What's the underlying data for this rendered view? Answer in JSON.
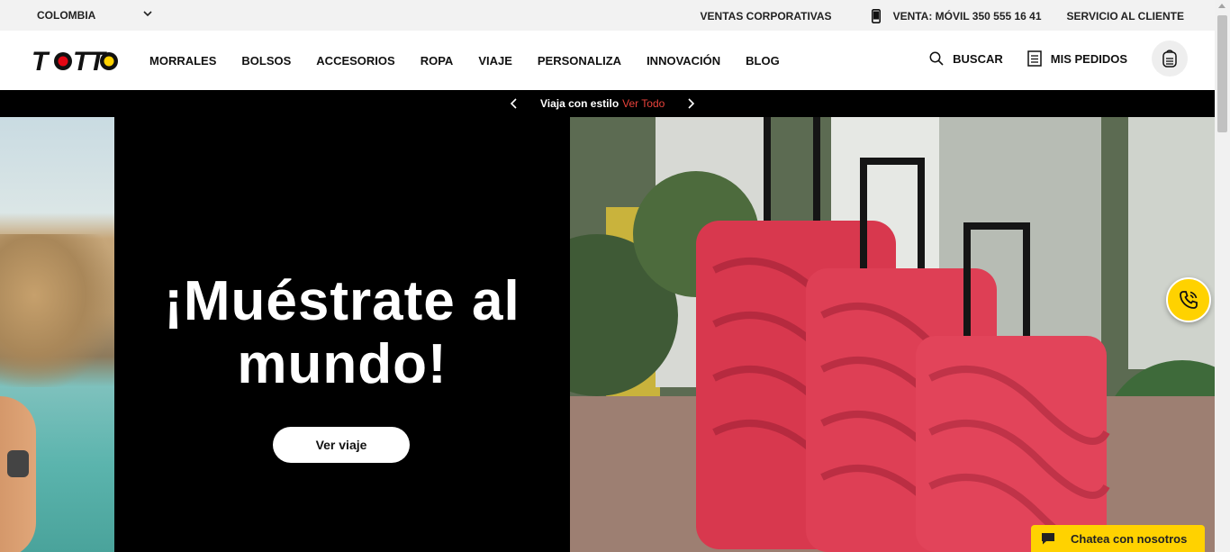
{
  "topbar": {
    "country": "COLOMBIA",
    "corporate_sales": "VENTAS CORPORATIVAS",
    "phone_sales": "VENTA: MÓVIL 350 555 16 41",
    "customer_service": "SERVICIO AL CLIENTE"
  },
  "header": {
    "logo_text": "TOTTO",
    "nav": [
      "MORRALES",
      "BOLSOS",
      "ACCESORIOS",
      "ROPA",
      "VIAJE",
      "PERSONALIZA",
      "INNOVACIÓN",
      "BLOG"
    ],
    "search_label": "BUSCAR",
    "orders_label": "MIS PEDIDOS"
  },
  "promo": {
    "text": "Viaja con estilo",
    "link": "Ver Todo",
    "prev_icon": "chevron-left-icon",
    "next_icon": "chevron-right-icon"
  },
  "hero": {
    "title_line1": "¡Muéstrate al",
    "title_line2": "mundo!",
    "cta": "Ver viaje"
  },
  "chat": {
    "label": "Chatea con nosotros"
  },
  "colors": {
    "accent_yellow": "#ffd200",
    "promo_red": "#e8423b",
    "luggage_red": "#d8384e",
    "logo_red": "#e30613"
  }
}
